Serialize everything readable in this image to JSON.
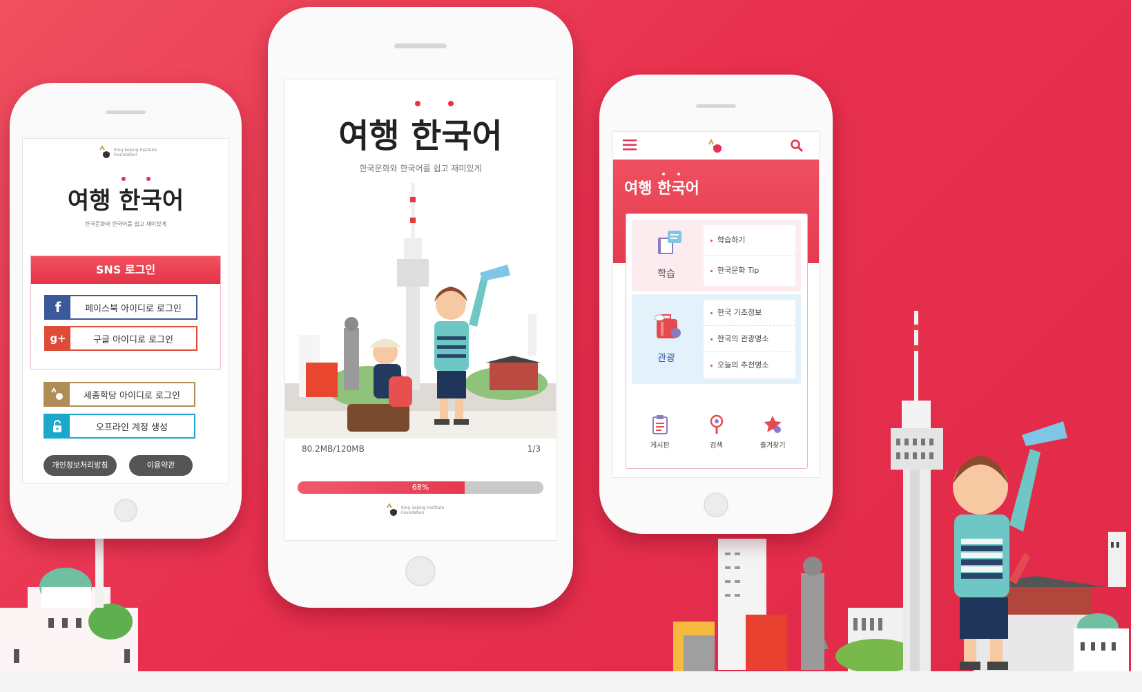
{
  "phone_login": {
    "title": "여행 한국어",
    "subtitle": "한국문화와 한국어를 쉽고 재미있게",
    "logo_text": "King Sejong Institute Foundation",
    "sns_header": "SNS 로그인",
    "facebook_icon_glyph": "f",
    "facebook_login": "페이스북 아이디로 로그인",
    "google_icon_glyph": "g+",
    "google_login": "구글 아이디로 로그인",
    "sejong_login": "세종학당 아이디로 로그인",
    "offline_account": "오프라인 계정 생성",
    "privacy_policy": "개인정보처리방침",
    "terms": "이용약관",
    "colors": {
      "facebook": "#3b5998",
      "google": "#dd4b39",
      "sejong": "#b08d57",
      "offline": "#1ba8cf"
    }
  },
  "phone_loading": {
    "title": "여행 한국어",
    "subtitle": "한국문화와 한국어를 쉽고 재미있게",
    "download_size": "80.2MB/120MB",
    "page_indicator": "1/3",
    "progress_label": "68%",
    "progress_value": 0.68,
    "logo_text": "King Sejong Institute Foundation"
  },
  "phone_menu": {
    "hero_title": "여행 한국어",
    "icons": {
      "menu": "hamburger-icon",
      "search": "search-icon",
      "logo": "sejong-logo-icon"
    },
    "study": {
      "label": "학습",
      "links": [
        "학습하기",
        "한국문화 Tip"
      ]
    },
    "tourism": {
      "label": "관광",
      "links": [
        "한국 기초정보",
        "한국의 관광명소",
        "오늘의 추천명소"
      ]
    },
    "nav": [
      {
        "label": "게시판",
        "icon": "clipboard-icon"
      },
      {
        "label": "검색",
        "icon": "location-pin-icon"
      },
      {
        "label": "즐겨찾기",
        "icon": "star-icon"
      }
    ]
  },
  "colors": {
    "brand_red": "#e8304f",
    "accent_pink": "#f05a6c",
    "tourism_bg": "#e3f1fb",
    "study_bg": "#fdecef"
  }
}
